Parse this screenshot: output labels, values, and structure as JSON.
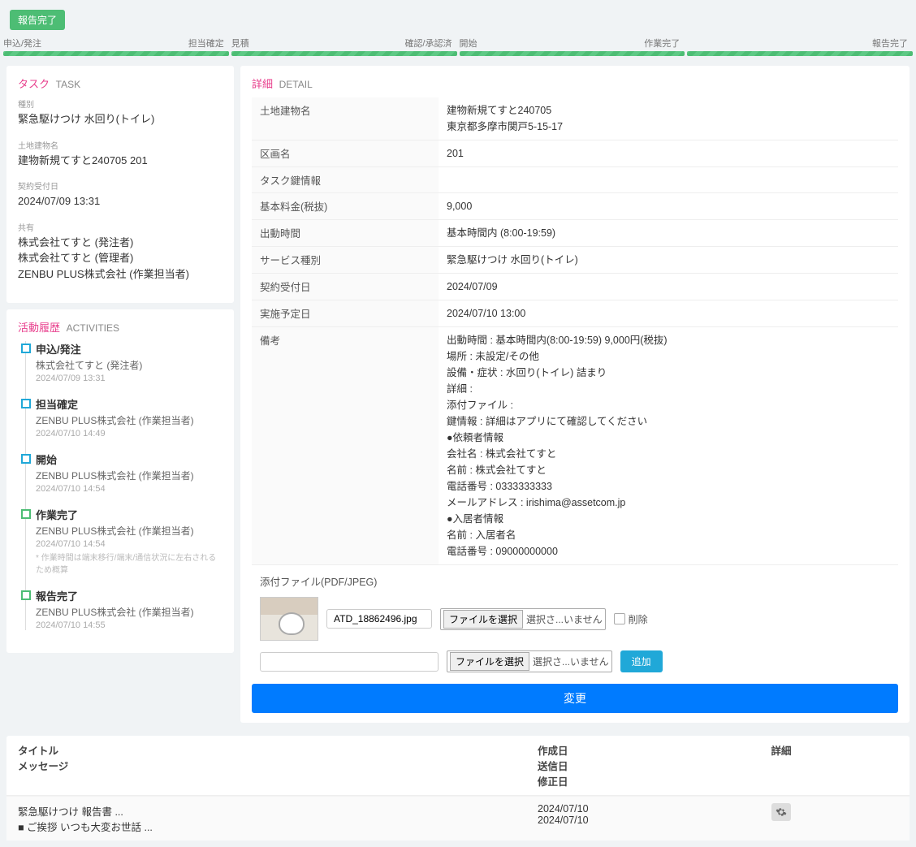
{
  "status_badge": "報告完了",
  "progress": [
    {
      "left": "申込/発注",
      "right": "担当確定"
    },
    {
      "left": "見積",
      "right": "確認/承認済"
    },
    {
      "left": "開始",
      "right": "作業完了"
    },
    {
      "left": "",
      "right": "報告完了"
    }
  ],
  "task_section": {
    "title_jp": "タスク",
    "title_en": "TASK",
    "items": [
      {
        "label": "種別",
        "value": "緊急駆けつけ 水回り(トイレ)"
      },
      {
        "label": "土地建物名",
        "value": "建物新規てすと240705 201"
      },
      {
        "label": "契約受付日",
        "value": "2024/07/09 13:31"
      },
      {
        "label": "共有",
        "value": "株式会社てすと (発注者)\n株式会社てすと (管理者)\nZENBU PLUS株式会社 (作業担当者)"
      }
    ]
  },
  "activities_section": {
    "title_jp": "活動履歴",
    "title_en": "ACTIVITIES",
    "items": [
      {
        "title": "申込/発注",
        "sub": "株式会社てすと (発注者)",
        "time": "2024/07/09 13:31",
        "done": false
      },
      {
        "title": "担当確定",
        "sub": "ZENBU PLUS株式会社 (作業担当者)",
        "time": "2024/07/10 14:49",
        "done": false
      },
      {
        "title": "開始",
        "sub": "ZENBU PLUS株式会社 (作業担当者)",
        "time": "2024/07/10 14:54",
        "done": false
      },
      {
        "title": "作業完了",
        "sub": "ZENBU PLUS株式会社 (作業担当者)",
        "time": "2024/07/10 14:54",
        "note": "* 作業時間は端末移行/端末/通信状況に左右されるため概算",
        "done": true
      },
      {
        "title": "報告完了",
        "sub": "ZENBU PLUS株式会社 (作業担当者)",
        "time": "2024/07/10 14:55",
        "done": true
      }
    ]
  },
  "detail_section": {
    "title_jp": "詳細",
    "title_en": "DETAIL",
    "rows": [
      {
        "k": "土地建物名",
        "v": "建物新規てすと240705\n東京都多摩市関戸5-15-17"
      },
      {
        "k": "区画名",
        "v": "201"
      },
      {
        "k": "タスク鍵情報",
        "v": ""
      },
      {
        "k": "基本料金(税抜)",
        "v": "9,000"
      },
      {
        "k": "出動時間",
        "v": "基本時間内 (8:00-19:59)"
      },
      {
        "k": "サービス種別",
        "v": "緊急駆けつけ 水回り(トイレ)"
      },
      {
        "k": "契約受付日",
        "v": "2024/07/09"
      },
      {
        "k": "実施予定日",
        "v": "2024/07/10 13:00"
      },
      {
        "k": "備考",
        "v": "出動時間 : 基本時間内(8:00-19:59) 9,000円(税抜)\n場所 : 未設定/その他\n設備・症状 : 水回り(トイレ) 詰まり\n詳細 :\n添付ファイル :\n鍵情報 : 詳細はアプリにて確認してください\n●依頼者情報\n会社名 : 株式会社てすと\n名前 : 株式会社てすと\n電話番号 : 0333333333\nメールアドレス : irishima@assetcom.jp\n●入居者情報\n名前 : 入居者名\n電話番号 : 09000000000"
      }
    ],
    "attach_label": "添付ファイル(PDF/JPEG)",
    "file_rows": [
      {
        "filename": "ATD_18862496.jpg",
        "choose_label": "ファイルを選択",
        "status": "選択さ...いません",
        "has_thumb": true,
        "delete_label": "削除"
      },
      {
        "filename": "",
        "choose_label": "ファイルを選択",
        "status": "選択さ...いません",
        "has_thumb": false,
        "add_label": "追加"
      }
    ],
    "change_button": "変更"
  },
  "report_section": {
    "hdr_col1a": "タイトル",
    "hdr_col1b": "メッセージ",
    "hdr_col2a": "作成日",
    "hdr_col2b": "送信日",
    "hdr_col2c": "修正日",
    "hdr_col3": "詳細",
    "row": {
      "col1a": "緊急駆けつけ 報告書 ...",
      "col1b": "■ ご挨拶 いつも大変お世話 ...",
      "col2a": "2024/07/10",
      "col2b": "2024/07/10"
    }
  }
}
